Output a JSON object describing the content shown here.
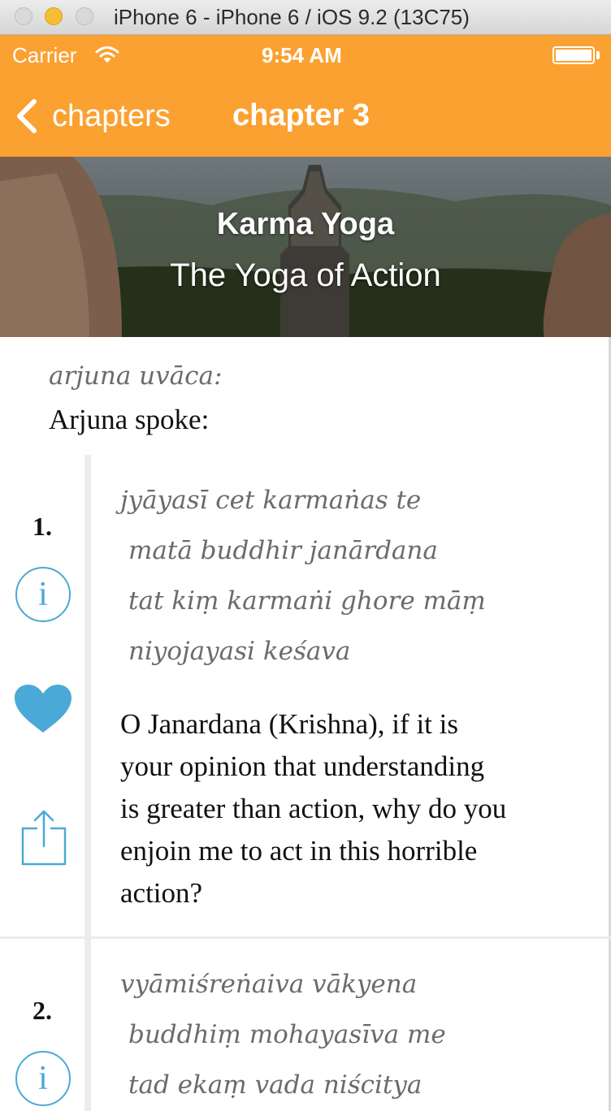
{
  "window": {
    "title": "iPhone 6 - iPhone 6 / iOS 9.2 (13C75)"
  },
  "status_bar": {
    "carrier": "Carrier",
    "time": "9:54 AM"
  },
  "nav": {
    "back_label": "chapters",
    "title": "chapter 3"
  },
  "hero": {
    "title": "Karma Yoga",
    "subtitle": "The Yoga of Action"
  },
  "speaker": {
    "sanskrit": "arjuna uvāca:",
    "english": "Arjuna spoke:"
  },
  "colors": {
    "accent": "#fba131",
    "icon_blue": "#4aa9d6",
    "divider": "#ececec"
  },
  "verses": [
    {
      "number": "1.",
      "sanskrit": [
        "jyāyasī cet karmaṅas te",
        "matā buddhir janārdana",
        "tat kiṃ karmaṅi ghore māṃ",
        "niyojayasi keśava"
      ],
      "translation": [
        "O Janardana (Krishna), if it is",
        "your opinion that understanding",
        "is greater than action, why do you",
        "enjoin me to act in this horrible",
        "action?"
      ]
    },
    {
      "number": "2.",
      "sanskrit": [
        "vyāmiśreṅaiva vākyena",
        "buddhiṃ mohayasīva me",
        "tad ekaṃ vada niścitya"
      ]
    }
  ],
  "icons": {
    "info": "i",
    "favorite": "heart-icon",
    "share": "share-icon",
    "back": "chevron-left-icon",
    "wifi": "wifi-icon",
    "battery": "battery-icon"
  }
}
